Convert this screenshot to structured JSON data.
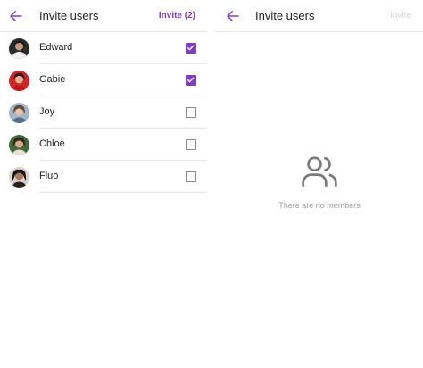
{
  "left": {
    "title": "Invite users",
    "action": "Invite (2)",
    "users": [
      {
        "name": "Edward",
        "checked": true
      },
      {
        "name": "Gabie",
        "checked": true
      },
      {
        "name": "Joy",
        "checked": false
      },
      {
        "name": "Chloe",
        "checked": false
      },
      {
        "name": "Fluo",
        "checked": false
      }
    ]
  },
  "right": {
    "title": "Invite users",
    "action": "Invite",
    "empty_message": "There are no members"
  },
  "colors": {
    "accent": "#7e3ec1",
    "divider": "#e6e6e6",
    "muted_text": "#9a9a9a"
  },
  "icons": {
    "back": "arrow-left-icon",
    "empty": "users-icon",
    "check": "checkmark-icon"
  }
}
